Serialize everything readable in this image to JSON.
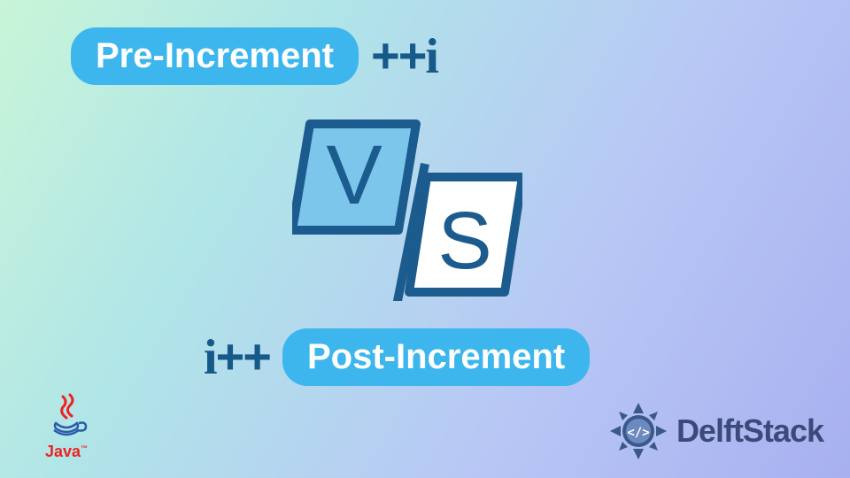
{
  "preIncrement": {
    "label": "Pre-Increment",
    "operator": "++i"
  },
  "postIncrement": {
    "label": "Post-Increment",
    "operator": "i++"
  },
  "vs": {
    "letterV": "V",
    "letterS": "S"
  },
  "brand": {
    "delft": "DelftStack",
    "java": "Java",
    "javaTM": "™"
  },
  "colors": {
    "pill": "#3cb6ed",
    "darkBlue": "#175a8a",
    "outline": "#1b5b8e"
  }
}
